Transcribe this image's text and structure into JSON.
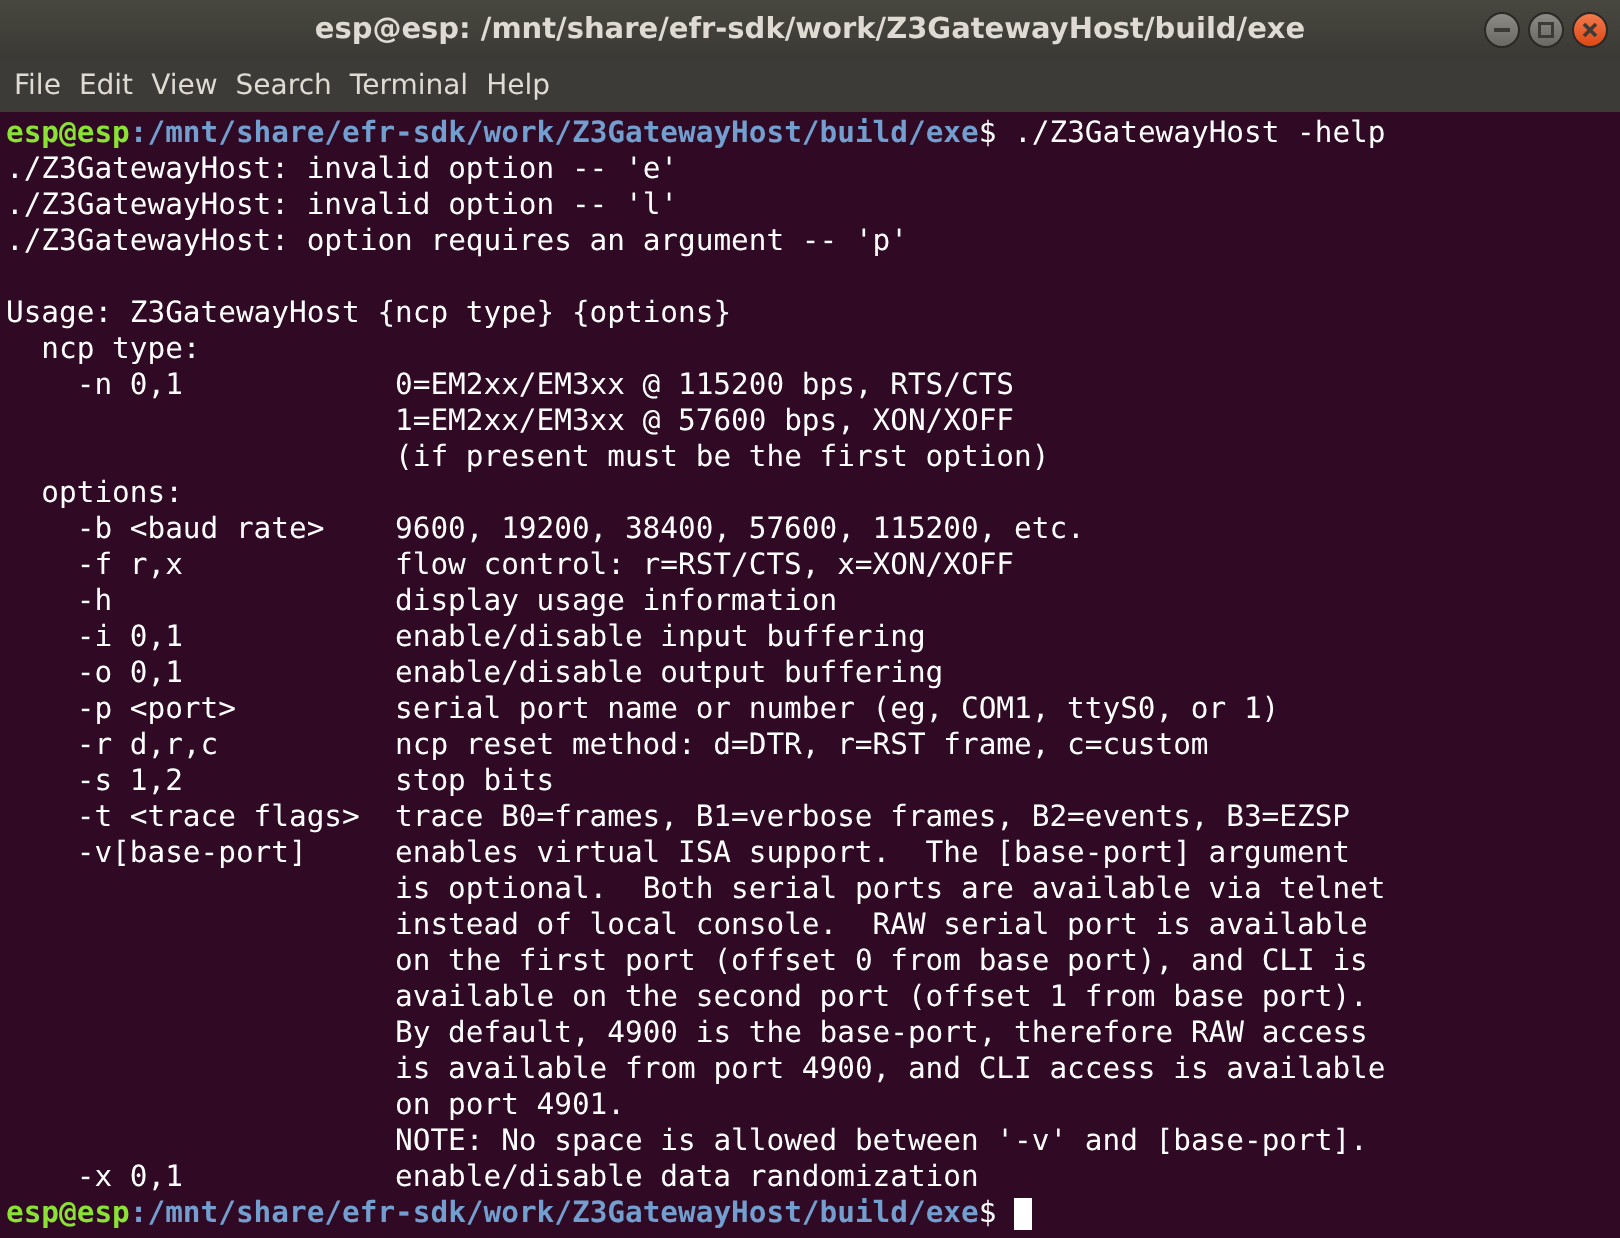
{
  "window": {
    "title": "esp@esp: /mnt/share/efr-sdk/work/Z3GatewayHost/build/exe"
  },
  "menu": [
    "File",
    "Edit",
    "View",
    "Search",
    "Terminal",
    "Help"
  ],
  "terminal": {
    "lines": [
      {
        "kind": "prompt",
        "user": "esp@esp",
        "path": ":/mnt/share/efr-sdk/work/Z3GatewayHost/build/exe",
        "symbol": "$",
        "command": " ./Z3GatewayHost -help"
      },
      {
        "kind": "text",
        "text": "./Z3GatewayHost: invalid option -- 'e'"
      },
      {
        "kind": "text",
        "text": "./Z3GatewayHost: invalid option -- 'l'"
      },
      {
        "kind": "text",
        "text": "./Z3GatewayHost: option requires an argument -- 'p'"
      },
      {
        "kind": "blank"
      },
      {
        "kind": "text",
        "text": "Usage: Z3GatewayHost {ncp type} {options}"
      },
      {
        "kind": "section",
        "text": "ncp type:"
      },
      {
        "kind": "option",
        "flag": "-n 0,1",
        "description": "0=EM2xx/EM3xx @ 115200 bps, RTS/CTS"
      },
      {
        "kind": "continuation",
        "description": "1=EM2xx/EM3xx @ 57600 bps, XON/XOFF"
      },
      {
        "kind": "continuation",
        "description": "(if present must be the first option)"
      },
      {
        "kind": "section",
        "text": "options:"
      },
      {
        "kind": "option",
        "flag": "-b <baud rate>",
        "description": "9600, 19200, 38400, 57600, 115200, etc."
      },
      {
        "kind": "option",
        "flag": "-f r,x",
        "description": "flow control: r=RST/CTS, x=XON/XOFF"
      },
      {
        "kind": "option",
        "flag": "-h",
        "description": "display usage information"
      },
      {
        "kind": "option",
        "flag": "-i 0,1",
        "description": "enable/disable input buffering"
      },
      {
        "kind": "option",
        "flag": "-o 0,1",
        "description": "enable/disable output buffering"
      },
      {
        "kind": "option",
        "flag": "-p <port>",
        "description": "serial port name or number (eg, COM1, ttyS0, or 1)"
      },
      {
        "kind": "option",
        "flag": "-r d,r,c",
        "description": "ncp reset method: d=DTR, r=RST frame, c=custom"
      },
      {
        "kind": "option",
        "flag": "-s 1,2",
        "description": "stop bits"
      },
      {
        "kind": "option",
        "flag": "-t <trace flags>",
        "description": "trace B0=frames, B1=verbose frames, B2=events, B3=EZSP"
      },
      {
        "kind": "option",
        "flag": "-v[base-port]",
        "description": "enables virtual ISA support.  The [base-port] argument"
      },
      {
        "kind": "continuation",
        "description": "is optional.  Both serial ports are available via telnet"
      },
      {
        "kind": "continuation",
        "description": "instead of local console.  RAW serial port is available"
      },
      {
        "kind": "continuation",
        "description": "on the first port (offset 0 from base port), and CLI is"
      },
      {
        "kind": "continuation",
        "description": "available on the second port (offset 1 from base port)."
      },
      {
        "kind": "continuation",
        "description": "By default, 4900 is the base-port, therefore RAW access"
      },
      {
        "kind": "continuation",
        "description": "is available from port 4900, and CLI access is available"
      },
      {
        "kind": "continuation",
        "description": "on port 4901."
      },
      {
        "kind": "continuation",
        "description": "NOTE: No space is allowed between '-v' and [base-port]."
      },
      {
        "kind": "option",
        "flag": "-x 0,1",
        "description": "enable/disable data randomization"
      },
      {
        "kind": "prompt",
        "user": "esp@esp",
        "path": ":/mnt/share/efr-sdk/work/Z3GatewayHost/build/exe",
        "symbol": "$",
        "cursor": true
      }
    ]
  }
}
